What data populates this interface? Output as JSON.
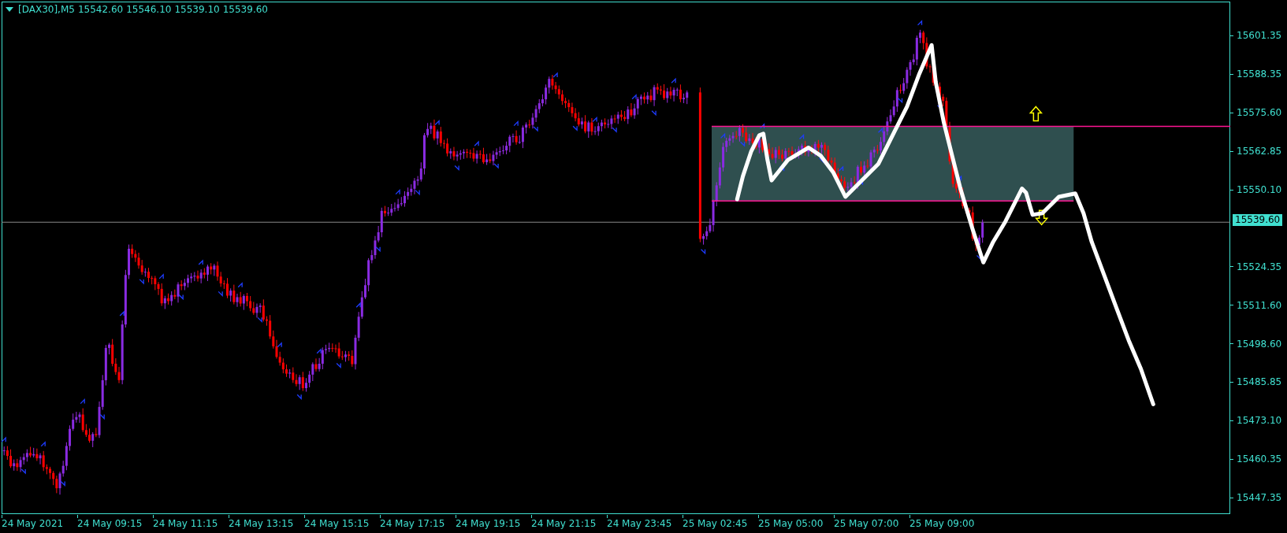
{
  "header": {
    "symbol": "[DAX30],M5",
    "quotes": [
      "15542.60",
      "15546.10",
      "15539.10",
      "15539.60"
    ]
  },
  "price_axis": {
    "labels": [
      "15601.35",
      "15588.35",
      "15575.60",
      "15562.85",
      "15550.10",
      "15524.35",
      "15511.60",
      "15498.60",
      "15485.85",
      "15473.10",
      "15460.35",
      "15447.35"
    ],
    "current_price": "15539.60"
  },
  "time_axis": {
    "labels": [
      "24 May 2021",
      "24 May 09:15",
      "24 May 11:15",
      "24 May 13:15",
      "24 May 15:15",
      "24 May 17:15",
      "24 May 19:15",
      "24 May 21:15",
      "24 May 23:45",
      "25 May 02:45",
      "25 May 05:00",
      "25 May 07:00",
      "25 May 09:00"
    ]
  }
}
